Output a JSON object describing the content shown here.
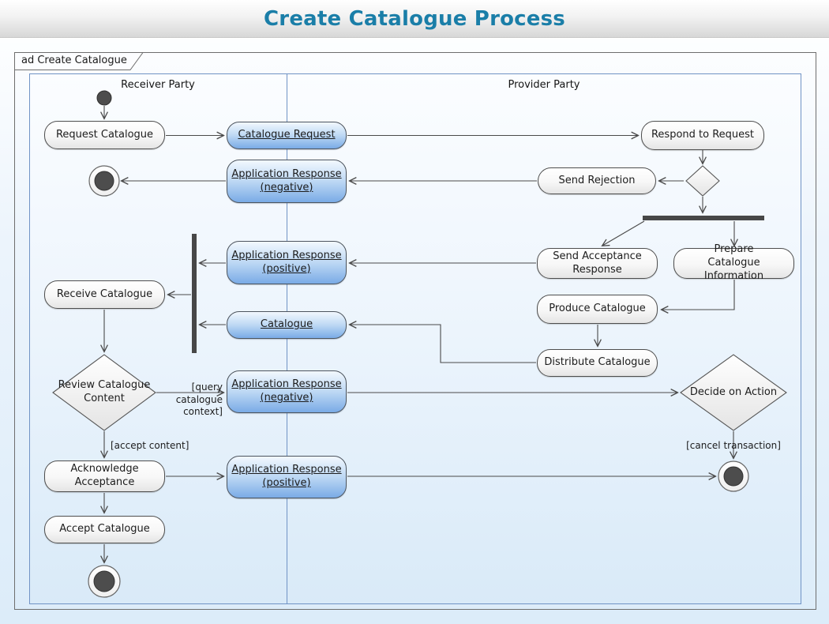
{
  "header": {
    "title": "Create Catalogue Process"
  },
  "frame": {
    "tab_label": "ad Create Catalogue"
  },
  "lanes": {
    "receiver": {
      "label": "Receiver Party"
    },
    "provider": {
      "label": "Provider Party"
    }
  },
  "nodes": {
    "request_catalogue": "Request Catalogue",
    "catalogue_request": "Catalogue Request",
    "respond_to_request": "Respond to Request",
    "app_response_negative_1": "Application Response (negative)",
    "send_rejection": "Send Rejection",
    "send_acceptance_response": "Send Acceptance Response",
    "prepare_catalogue_information": "Prepare Catalogue Information",
    "app_response_positive_1": "Application Response (positive)",
    "receive_catalogue": "Receive Catalogue",
    "produce_catalogue": "Produce Catalogue",
    "catalogue": "Catalogue",
    "distribute_catalogue": "Distribute Catalogue",
    "review_catalogue_content": "Review Catalogue Content",
    "app_response_negative_2": "Application Response (negative)",
    "decide_on_action": "Decide on Action",
    "acknowledge_acceptance": "Acknowledge Acceptance",
    "app_response_positive_2": "Application Response (positive)",
    "accept_catalogue": "Accept Catalogue"
  },
  "guards": {
    "query_catalogue_context": "[query catalogue context]",
    "accept_content": "[accept content]",
    "cancel_transaction": "[cancel transaction]"
  },
  "colors": {
    "title_text": "#1a7ea8",
    "object_node_bottom": "#7aabe6",
    "action_node_bottom": "#e5e5e5",
    "lane_border": "#7093c5",
    "frame_border": "#6e6e6e",
    "edge_stroke": "#4a4a4a",
    "node_dark_fill": "#4d4d4d"
  }
}
